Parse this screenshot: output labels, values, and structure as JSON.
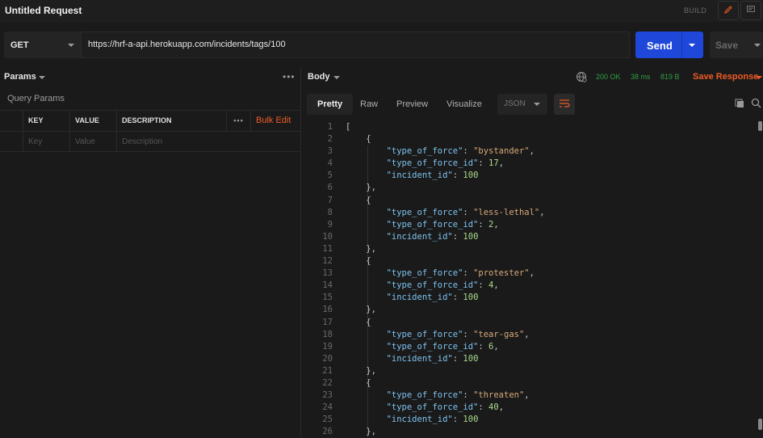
{
  "titlebar": {
    "title": "Untitled Request",
    "build_label": "BUILD"
  },
  "request": {
    "method": "GET",
    "url": "https://hrf-a-api.herokuapp.com/incidents/tags/100",
    "send_label": "Send",
    "save_label": "Save"
  },
  "params": {
    "tab_label": "Params",
    "more_label": "•••",
    "section_label": "Query Params",
    "columns": {
      "key": "KEY",
      "value": "VALUE",
      "description": "DESCRIPTION"
    },
    "bulk_edit_label": "Bulk Edit",
    "placeholders": {
      "key": "Key",
      "value": "Value",
      "description": "Description"
    }
  },
  "response": {
    "tab_label": "Body",
    "status": "200 OK",
    "time": "38 ms",
    "size": "819 B",
    "save_response_label": "Save Response",
    "view_tabs": [
      "Pretty",
      "Raw",
      "Preview",
      "Visualize"
    ],
    "active_view": "Pretty",
    "format": "JSON",
    "lines": [
      {
        "n": "1",
        "indent": 0,
        "parts": [
          [
            "p",
            "["
          ]
        ]
      },
      {
        "n": "2",
        "indent": 1,
        "parts": [
          [
            "p",
            "{"
          ]
        ]
      },
      {
        "n": "3",
        "indent": 2,
        "parts": [
          [
            "k",
            "\"type_of_force\""
          ],
          [
            "p",
            ": "
          ],
          [
            "s",
            "\"bystander\""
          ],
          [
            "p",
            ","
          ]
        ]
      },
      {
        "n": "4",
        "indent": 2,
        "parts": [
          [
            "k",
            "\"type_of_force_id\""
          ],
          [
            "p",
            ": "
          ],
          [
            "n",
            "17"
          ],
          [
            "p",
            ","
          ]
        ]
      },
      {
        "n": "5",
        "indent": 2,
        "parts": [
          [
            "k",
            "\"incident_id\""
          ],
          [
            "p",
            ": "
          ],
          [
            "n",
            "100"
          ]
        ]
      },
      {
        "n": "6",
        "indent": 1,
        "parts": [
          [
            "p",
            "},"
          ]
        ]
      },
      {
        "n": "7",
        "indent": 1,
        "parts": [
          [
            "p",
            "{"
          ]
        ]
      },
      {
        "n": "8",
        "indent": 2,
        "parts": [
          [
            "k",
            "\"type_of_force\""
          ],
          [
            "p",
            ": "
          ],
          [
            "s",
            "\"less-lethal\""
          ],
          [
            "p",
            ","
          ]
        ]
      },
      {
        "n": "9",
        "indent": 2,
        "parts": [
          [
            "k",
            "\"type_of_force_id\""
          ],
          [
            "p",
            ": "
          ],
          [
            "n",
            "2"
          ],
          [
            "p",
            ","
          ]
        ]
      },
      {
        "n": "10",
        "indent": 2,
        "parts": [
          [
            "k",
            "\"incident_id\""
          ],
          [
            "p",
            ": "
          ],
          [
            "n",
            "100"
          ]
        ]
      },
      {
        "n": "11",
        "indent": 1,
        "parts": [
          [
            "p",
            "},"
          ]
        ]
      },
      {
        "n": "12",
        "indent": 1,
        "parts": [
          [
            "p",
            "{"
          ]
        ]
      },
      {
        "n": "13",
        "indent": 2,
        "parts": [
          [
            "k",
            "\"type_of_force\""
          ],
          [
            "p",
            ": "
          ],
          [
            "s",
            "\"protester\""
          ],
          [
            "p",
            ","
          ]
        ]
      },
      {
        "n": "14",
        "indent": 2,
        "parts": [
          [
            "k",
            "\"type_of_force_id\""
          ],
          [
            "p",
            ": "
          ],
          [
            "n",
            "4"
          ],
          [
            "p",
            ","
          ]
        ]
      },
      {
        "n": "15",
        "indent": 2,
        "parts": [
          [
            "k",
            "\"incident_id\""
          ],
          [
            "p",
            ": "
          ],
          [
            "n",
            "100"
          ]
        ]
      },
      {
        "n": "16",
        "indent": 1,
        "parts": [
          [
            "p",
            "},"
          ]
        ]
      },
      {
        "n": "17",
        "indent": 1,
        "parts": [
          [
            "p",
            "{"
          ]
        ]
      },
      {
        "n": "18",
        "indent": 2,
        "parts": [
          [
            "k",
            "\"type_of_force\""
          ],
          [
            "p",
            ": "
          ],
          [
            "s",
            "\"tear-gas\""
          ],
          [
            "p",
            ","
          ]
        ]
      },
      {
        "n": "19",
        "indent": 2,
        "parts": [
          [
            "k",
            "\"type_of_force_id\""
          ],
          [
            "p",
            ": "
          ],
          [
            "n",
            "6"
          ],
          [
            "p",
            ","
          ]
        ]
      },
      {
        "n": "20",
        "indent": 2,
        "parts": [
          [
            "k",
            "\"incident_id\""
          ],
          [
            "p",
            ": "
          ],
          [
            "n",
            "100"
          ]
        ]
      },
      {
        "n": "21",
        "indent": 1,
        "parts": [
          [
            "p",
            "},"
          ]
        ]
      },
      {
        "n": "22",
        "indent": 1,
        "parts": [
          [
            "p",
            "{"
          ]
        ]
      },
      {
        "n": "23",
        "indent": 2,
        "parts": [
          [
            "k",
            "\"type_of_force\""
          ],
          [
            "p",
            ": "
          ],
          [
            "s",
            "\"threaten\""
          ],
          [
            "p",
            ","
          ]
        ]
      },
      {
        "n": "24",
        "indent": 2,
        "parts": [
          [
            "k",
            "\"type_of_force_id\""
          ],
          [
            "p",
            ": "
          ],
          [
            "n",
            "40"
          ],
          [
            "p",
            ","
          ]
        ]
      },
      {
        "n": "25",
        "indent": 2,
        "parts": [
          [
            "k",
            "\"incident_id\""
          ],
          [
            "p",
            ": "
          ],
          [
            "n",
            "100"
          ]
        ]
      },
      {
        "n": "26",
        "indent": 1,
        "parts": [
          [
            "p",
            "},"
          ]
        ]
      }
    ]
  },
  "colors": {
    "accent": "#ef5b25",
    "send": "#1f47d9",
    "status_ok": "#2f9e44"
  },
  "icons": [
    "pencil-icon",
    "comment-icon",
    "globe-icon",
    "wrap-icon",
    "copy-icon",
    "search-icon"
  ]
}
